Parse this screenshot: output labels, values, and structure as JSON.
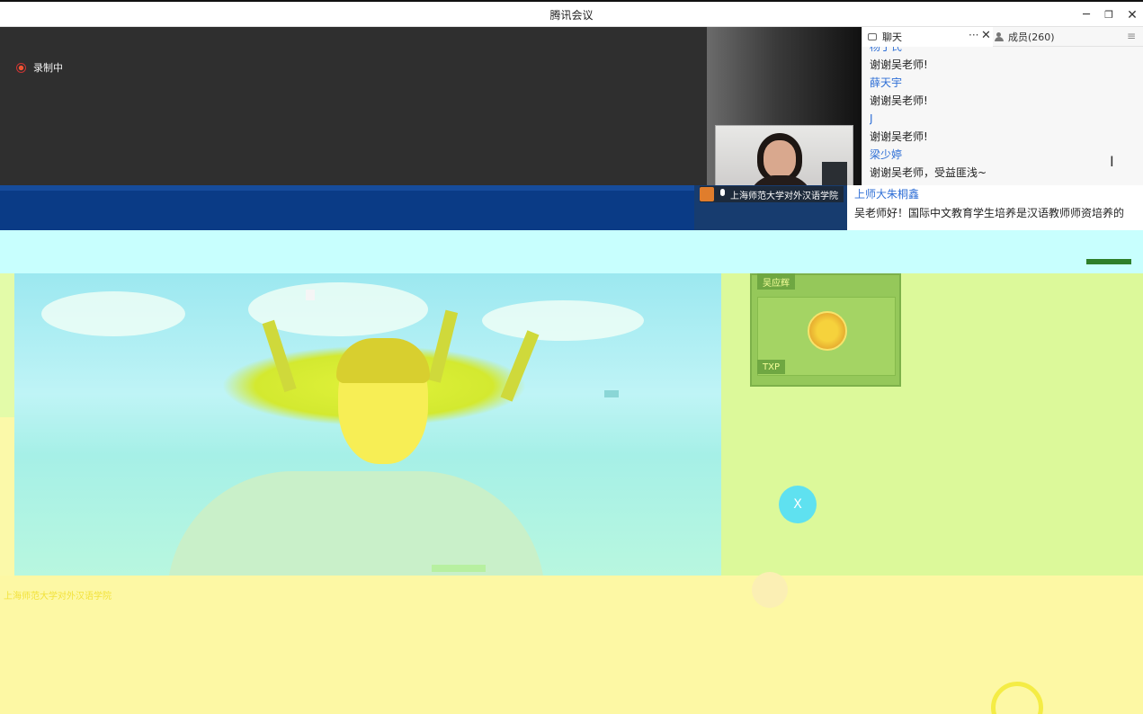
{
  "window": {
    "title": "腾讯会议",
    "minimize_glyph": "─",
    "maximize_glyph": "❐",
    "close_glyph": "✕"
  },
  "recording": {
    "label": "录制中"
  },
  "panel": {
    "chat_tab": "聊天",
    "more_glyph": "···",
    "close_glyph": "✕",
    "members_tab": "成员(260)",
    "menu_glyph": "≡",
    "messages": [
      {
        "type": "name",
        "text": "杨丁氏"
      },
      {
        "type": "text",
        "text": "谢谢吴老师!"
      },
      {
        "type": "name",
        "text": "薛天宇"
      },
      {
        "type": "text",
        "text": "谢谢吴老师!"
      },
      {
        "type": "name",
        "text": "J"
      },
      {
        "type": "text",
        "text": "谢谢吴老师!"
      },
      {
        "type": "name",
        "text": "梁少婷"
      },
      {
        "type": "text",
        "text": "谢谢吴老师，受益匪浅~"
      }
    ]
  },
  "shared_content": {
    "speaker_tag": "上海师范大学对外汉语学院",
    "inner_chat_name": "上师大朱桐鑫",
    "inner_chat_text": "吴老师好！国际中文教育学生培养是汉语教师师资培养的",
    "side_tag_1": "吴应辉",
    "side_tag_2": "TXP",
    "close_glyph": "X",
    "bottom_label": "上海师范大学对外汉语学院"
  },
  "colors": {
    "accent_blue": "#2f6fd6",
    "recording_red": "#e53",
    "dark_bg": "#2f2f2f"
  }
}
